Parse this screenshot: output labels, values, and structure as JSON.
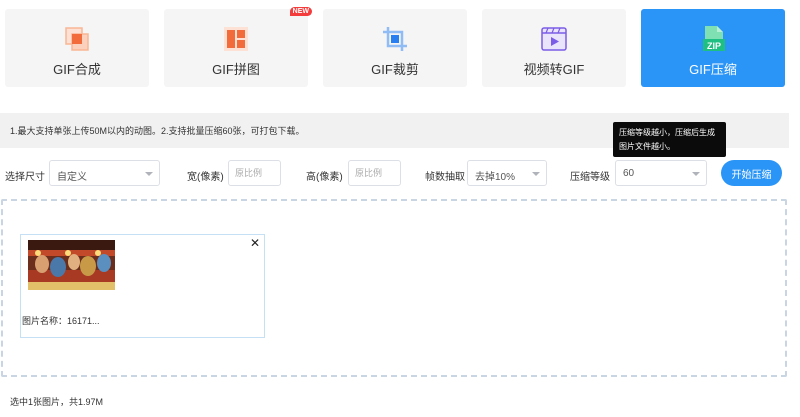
{
  "tools": [
    {
      "label": "GIF合成",
      "icon": "merge-squares-icon",
      "active": false,
      "badge": ""
    },
    {
      "label": "GIF拼图",
      "icon": "grid-layout-icon",
      "active": false,
      "badge": "NEW"
    },
    {
      "label": "GIF裁剪",
      "icon": "crop-icon",
      "active": false,
      "badge": ""
    },
    {
      "label": "视频转GIF",
      "icon": "video-play-icon",
      "active": false,
      "badge": ""
    },
    {
      "label": "GIF压缩",
      "icon": "zip-file-icon",
      "active": true,
      "badge": ""
    }
  ],
  "notice": "1.最大支持单张上传50M以内的动图。2.支持批量压缩60张，可打包下载。",
  "tooltip": {
    "line1": "压缩等级越小，压缩后生成",
    "line2": "图片文件越小。"
  },
  "settings": {
    "size_label": "选择尺寸",
    "size_value": "自定义",
    "width_label": "宽(像素)",
    "width_placeholder": "原比例",
    "height_label": "高(像素)",
    "height_placeholder": "原比例",
    "frame_label": "帧数抽取",
    "frame_value": "去掉10%",
    "level_label": "压缩等级",
    "level_value": "60",
    "start_label": "开始压缩"
  },
  "file": {
    "name_label": "图片名称：16171..."
  },
  "summary": "选中1张图片，共1.97M",
  "colors": {
    "accent": "#2a95f7",
    "badge": "#f53c3c",
    "icon_orange": "#f26b3a"
  }
}
